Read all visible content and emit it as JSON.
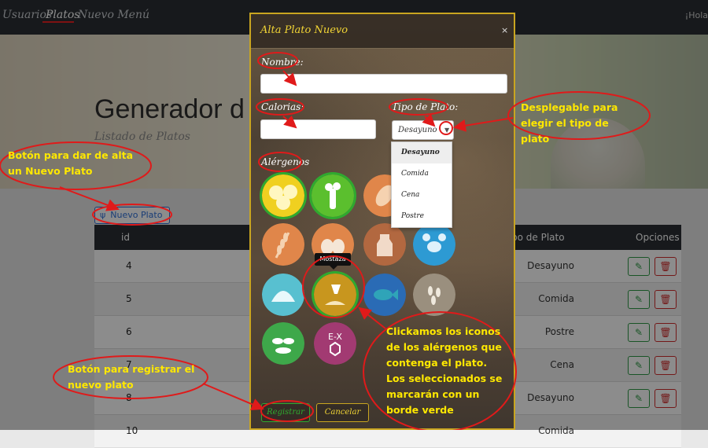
{
  "nav": {
    "items": [
      "Usuarios",
      "Platos",
      "Nuevo Menú"
    ],
    "user": "¡Hola"
  },
  "page": {
    "title": "Generador d",
    "subtitle": "Listado de Platos"
  },
  "new_button": {
    "icon": "fork-knife-icon",
    "label": "Nuevo Plato"
  },
  "table": {
    "headers": {
      "id": "id",
      "type": "po de Plato",
      "options": "Opciones"
    },
    "rows": [
      {
        "id": "4",
        "type": "Desayuno"
      },
      {
        "id": "5",
        "type": "Comida"
      },
      {
        "id": "6",
        "type": "Postre"
      },
      {
        "id": "7",
        "type": "Cena"
      },
      {
        "id": "8",
        "type": "Desayuno"
      },
      {
        "id": "10",
        "type": "Comida"
      }
    ]
  },
  "modal": {
    "title": "Alta Plato Nuevo",
    "close": "×",
    "nombre_label": "Nombre:",
    "nombre_value": "",
    "calorias_label": "Calorias:",
    "calorias_value": "",
    "tipo_label": "Tipo de Plato:",
    "tipo_selected": "Desayuno",
    "tipo_options": [
      "Desayuno",
      "Comida",
      "Cena",
      "Postre"
    ],
    "alergenos_label": "Alérgenos",
    "allergens": [
      {
        "name": "huevos-alt-icon",
        "color": "#f0d020",
        "selected": true
      },
      {
        "name": "apio-icon",
        "color": "#5bbf2e",
        "selected": true
      },
      {
        "name": "cacahuetes-icon",
        "color": "#e0864a",
        "selected": false
      },
      {
        "name": "cereales-gluten-icon",
        "color": "#e0864a",
        "selected": false
      },
      {
        "name": "huevos-icon",
        "color": "#e0864a",
        "selected": false
      },
      {
        "name": "lacteos-icon",
        "color": "#b26840",
        "selected": false
      },
      {
        "name": "crustaceos-icon",
        "color": "#2d9ad3",
        "selected": false
      },
      {
        "name": "moluscos-icon",
        "color": "#58c0d0",
        "selected": false
      },
      {
        "name": "mostaza-icon",
        "color": "#c8961e",
        "selected": true
      },
      {
        "name": "pescado-icon",
        "color": "#2a6bb5",
        "selected": false
      },
      {
        "name": "sesamo-icon",
        "color": "#9a8f7e",
        "selected": false
      },
      {
        "name": "soja-icon",
        "color": "#3ea84a",
        "selected": false
      },
      {
        "name": "sulfitos-icon",
        "color": "#a23a72",
        "selected": false
      }
    ],
    "tooltip": "Mostaza",
    "register": "Registrar",
    "cancel": "Cancelar"
  },
  "annotations": {
    "desplegable": "Desplegable para elegir el tipo de plato",
    "nuevo_plato": "Botón para dar de alta un Nuevo Plato",
    "registrar": "Botón para registrar el nuevo plato",
    "alergenos": "Clickamos los iconos de los alérgenos que contenga el plato. Los seleccionados se marcarán con un borde verde"
  },
  "colors": {
    "navbar": "#2b2f33",
    "modal_border": "#c9a520",
    "title_yellow": "#f2d535",
    "annotation_red": "#e01a1a",
    "annotation_yellow": "#ffe800",
    "selected_green": "#2faa2f"
  }
}
